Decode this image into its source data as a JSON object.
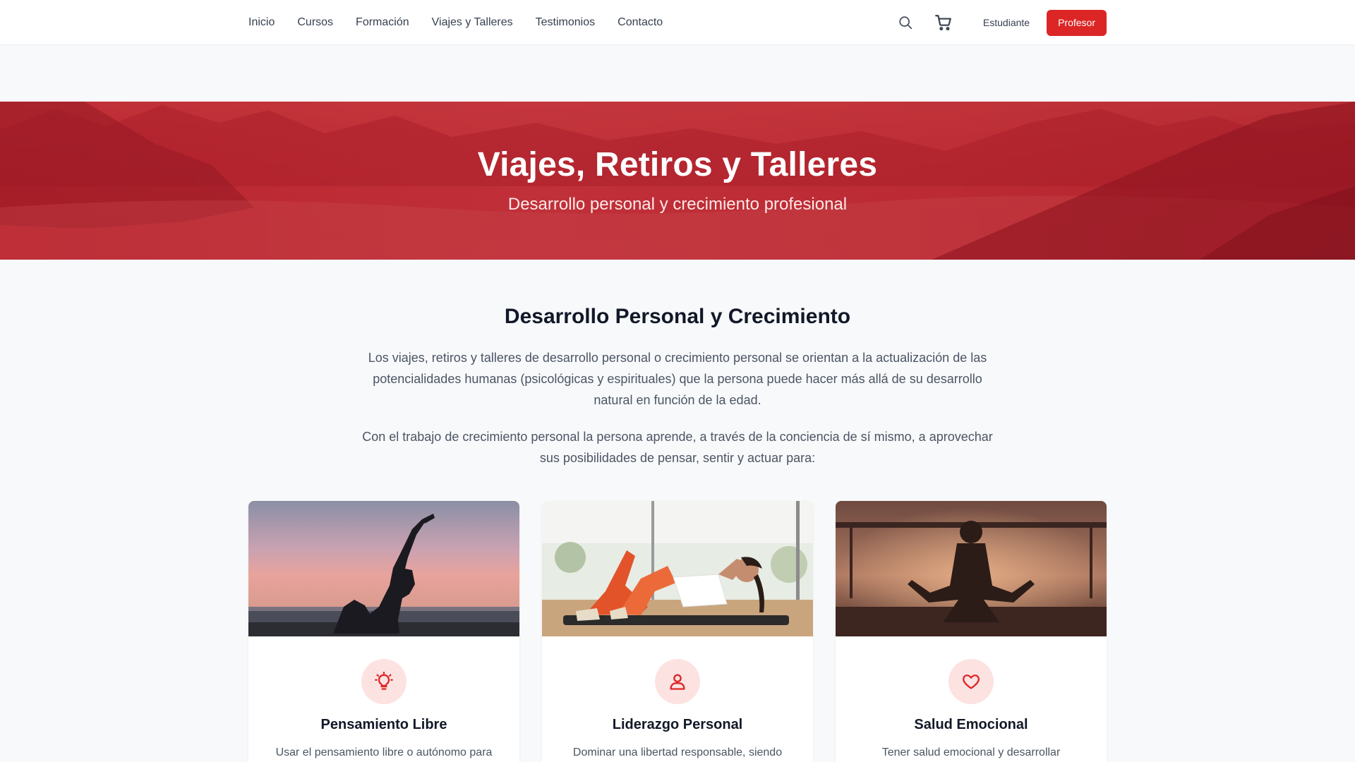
{
  "nav": {
    "items": [
      {
        "label": "Inicio"
      },
      {
        "label": "Cursos"
      },
      {
        "label": "Formación"
      },
      {
        "label": "Viajes y Talleres"
      },
      {
        "label": "Testimonios"
      },
      {
        "label": "Contacto"
      }
    ],
    "search_icon": "search-icon",
    "cart_icon": "cart-icon",
    "student_label": "Estudiante",
    "teacher_label": "Profesor"
  },
  "hero": {
    "title": "Viajes, Retiros y Talleres",
    "subtitle": "Desarrollo personal y crecimiento profesional"
  },
  "intro": {
    "title": "Desarrollo Personal y Crecimiento",
    "paragraph1": "Los viajes, retiros y talleres de desarrollo personal o crecimiento personal se orientan a la actualización de las potencialidades humanas (psicológicas y espirituales) que la persona puede hacer más allá de su desarrollo natural en función de la edad.",
    "paragraph2": "Con el trabajo de crecimiento personal la persona aprende, a través de la conciencia de sí mismo, a aprovechar sus posibilidades de pensar, sentir y actuar para:"
  },
  "cards": [
    {
      "icon": "lightbulb-icon",
      "title": "Pensamiento Libre",
      "text": "Usar el pensamiento libre o autónomo para"
    },
    {
      "icon": "user-icon",
      "title": "Liderazgo Personal",
      "text": "Dominar una libertad responsable, siendo"
    },
    {
      "icon": "heart-icon",
      "title": "Salud Emocional",
      "text": "Tener salud emocional y desarrollar"
    }
  ],
  "colors": {
    "accent": "#dc2626",
    "hero_red": "#c1313a",
    "icon_bg": "#fde2e2",
    "page_bg": "#f8f9fb"
  }
}
